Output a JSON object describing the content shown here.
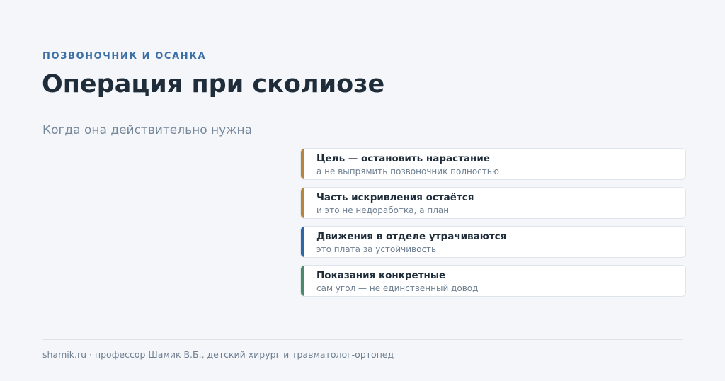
{
  "header": {
    "eyebrow": "ПОЗВОНОЧНИК И ОСАНКА",
    "title": "Операция при сколиозе",
    "subtitle": "Когда она действительно нужна"
  },
  "cards": [
    {
      "title": "Цель — остановить нарастание",
      "subtitle": "а не выпрямить позвоночник полностью",
      "accent": "#b8833a"
    },
    {
      "title": "Часть искривления остаётся",
      "subtitle": "и это не недоработка, а план",
      "accent": "#b8833a"
    },
    {
      "title": "Движения в отделе утрачиваются",
      "subtitle": "это плата за устойчивость",
      "accent": "#2f66a3"
    },
    {
      "title": "Показания конкретные",
      "subtitle": "сам угол — не единственный довод",
      "accent": "#4a8a68"
    }
  ],
  "footer": {
    "text": "shamik.ru · профессор Шамик В.Б., детский хирург и травматолог-ортопед"
  }
}
